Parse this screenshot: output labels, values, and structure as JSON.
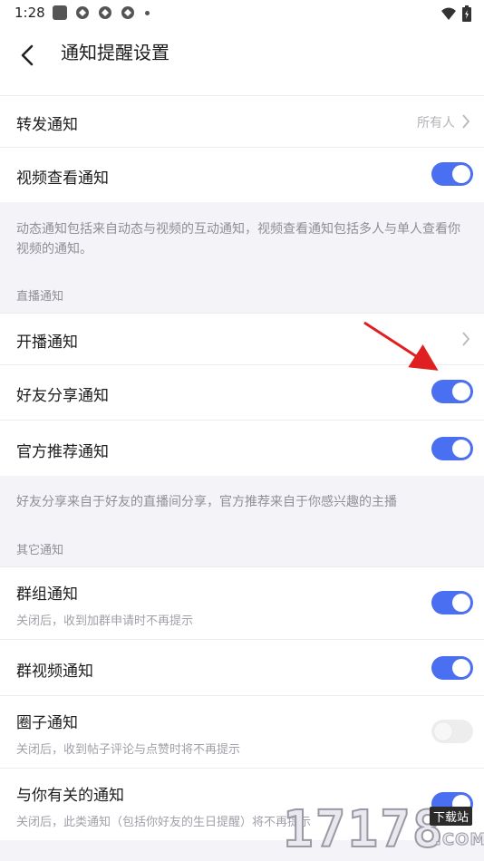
{
  "status": {
    "time": "1:28"
  },
  "header": {
    "title": "通知提醒设置"
  },
  "rows_top": {
    "forward": {
      "label": "转发通知",
      "value": "所有人"
    },
    "video_view": {
      "label": "视频查看通知",
      "on": true
    },
    "note": "动态通知包括来自动态与视频的互动通知，视频查看通知包括多人与单人查看你视频的通知。"
  },
  "live": {
    "section": "直播通知",
    "start": {
      "label": "开播通知"
    },
    "friend_share": {
      "label": "好友分享通知",
      "on": true
    },
    "official": {
      "label": "官方推荐通知",
      "on": true
    },
    "note": "好友分享来自于好友的直播间分享，官方推荐来自于你感兴趣的主播"
  },
  "other": {
    "section": "其它通知",
    "group": {
      "label": "群组通知",
      "sub": "关闭后，收到加群申请时不再提示",
      "on": true
    },
    "group_video": {
      "label": "群视频通知",
      "on": true
    },
    "circle": {
      "label": "圈子通知",
      "sub": "关闭后，收到帖子评论与点赞时将不再提示",
      "on": false
    },
    "related": {
      "label": "与你有关的通知",
      "sub": "关闭后，此类通知（包括你好友的生日提醒）将不再提示",
      "on": true
    }
  },
  "colors": {
    "accent": "#4a6ff0",
    "annotation_arrow": "#e02020"
  },
  "watermark": {
    "number": "17178",
    "badge": "下载站",
    "domain": ".COM"
  }
}
